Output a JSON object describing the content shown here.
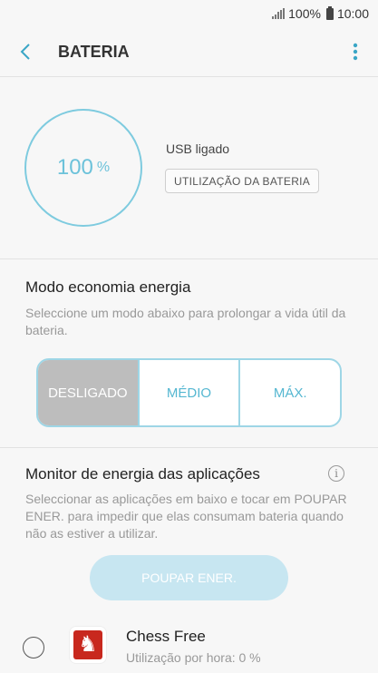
{
  "status_bar": {
    "battery_percent": "100%",
    "time": "10:00"
  },
  "header": {
    "title": "BATERIA"
  },
  "battery": {
    "level": "100",
    "unit": "%",
    "charging_status": "USB ligado",
    "usage_button": "UTILIZAÇÃO DA BATERIA"
  },
  "power_saving": {
    "title": "Modo economia energia",
    "description": "Seleccione um modo abaixo para prolongar a vida útil da bateria.",
    "modes": [
      "DESLIGADO",
      "MÉDIO",
      "MÁX."
    ],
    "selected": "DESLIGADO"
  },
  "app_power_monitor": {
    "title": "Monitor de energia das aplicações",
    "description": "Seleccionar as aplicações em baixo e tocar em POUPAR ENER. para impedir que elas consumam bateria quando não as estiver a utilizar.",
    "save_button": "POUPAR ENER.",
    "apps": [
      {
        "name": "Chess Free",
        "usage": "Utilização por hora: 0 %"
      }
    ]
  },
  "colors": {
    "accent": "#55b7d1",
    "gauge_ring": "#7ecbdf",
    "selected_segment": "#bdbdbd",
    "disabled_button": "#c7e6f1",
    "app_icon": "#c8281e"
  }
}
